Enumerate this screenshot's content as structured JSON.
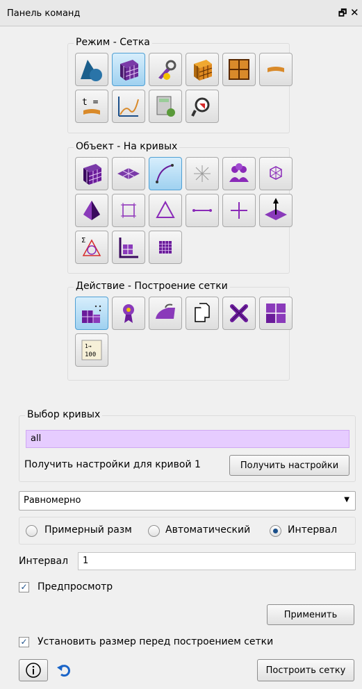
{
  "panel": {
    "title": "Панель команд"
  },
  "groups": {
    "mode": {
      "title": "Режим - Сетка",
      "buttons": [
        "geometry-mode-icon",
        "mesh-mode-icon",
        "tools-mode-icon",
        "elements-mode-icon",
        "blocks-mode-icon",
        "boundary-mode-icon",
        "time-zero-icon",
        "graph-icon",
        "calculator-icon",
        "inspect-icon"
      ]
    },
    "object": {
      "title": "Объект - На кривых",
      "buttons": [
        "volume-icon",
        "surface-icon",
        "curve-icon",
        "vertex-icon",
        "group-icon",
        "body-icon",
        "pyramid-icon",
        "square-icon",
        "triangle-icon",
        "edge-icon",
        "node-icon",
        "plane-normal-icon",
        "sigma-icon",
        "quad-grid-icon",
        "hex-grid-icon"
      ]
    },
    "action": {
      "title": "Действие - Построение сетки",
      "buttons": [
        "mesh-build-icon",
        "award-icon",
        "iron-icon",
        "copy-icon",
        "delete-icon",
        "refine-icon",
        "renumber-icon"
      ],
      "renumber_label": "1→100"
    }
  },
  "curve_selection": {
    "title": "Выбор кривых",
    "value": "all",
    "settings_label": "Получить настройки для кривой 1",
    "settings_button": "Получить настройки"
  },
  "scheme": {
    "selected": "Равномерно"
  },
  "radio": {
    "approx": "Примерный разм",
    "auto": "Автоматический",
    "interval": "Интервал",
    "selected": "interval"
  },
  "interval": {
    "label": "Интервал",
    "value": "1"
  },
  "preview": {
    "label": "Предпросмотр",
    "checked": true
  },
  "apply_button": "Применить",
  "set_size": {
    "label": "Установить размер перед построением сетки",
    "checked": true
  },
  "mesh_button": "Построить сетку",
  "colors": {
    "active": "#9fd1f0",
    "selection": "#e6ccff",
    "purple": "#6a1b9a"
  }
}
